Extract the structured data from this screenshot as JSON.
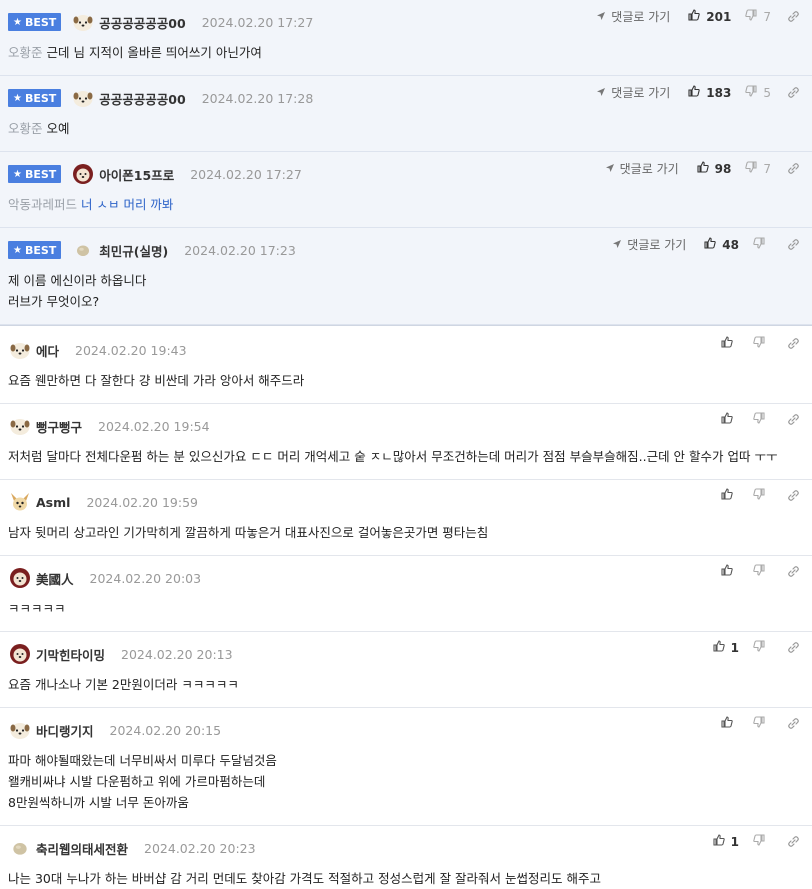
{
  "best_badge_label": "BEST",
  "goto_label": "댓글로 가기",
  "best_comments": [
    {
      "nick": "공공공공공공00",
      "date": "2024.02.20 17:27",
      "up": "201",
      "down": "7",
      "mention": "오황준",
      "text": "근데 님 지적이 올바른 띄어쓰기 아닌가여",
      "avatar": "dog-avatar-icon"
    },
    {
      "nick": "공공공공공공00",
      "date": "2024.02.20 17:28",
      "up": "183",
      "down": "5",
      "mention": "오황준",
      "text": "오예",
      "avatar": "dog-avatar-icon"
    },
    {
      "nick": "아이폰15프로",
      "date": "2024.02.20 17:27",
      "up": "98",
      "down": "7",
      "mention": "악동과레퍼드",
      "text": "너 ㅅㅂ 머리 까봐",
      "avatar": "poodle-avatar-icon"
    },
    {
      "nick": "최민규(실명)",
      "date": "2024.02.20 17:23",
      "up": "48",
      "down": "",
      "mention": "",
      "text": "제 이름 에신이라 하옵니다\n러브가 무엇이오?",
      "avatar": "blob-avatar-icon"
    }
  ],
  "comments": [
    {
      "nick": "에다",
      "date": "2024.02.20 19:43",
      "up": "",
      "text": "요즘 웬만하면 다 잘한다 걍 비싼데 가라 앙아서 해주드라",
      "avatar": "dog-avatar-icon"
    },
    {
      "nick": "뻥구뻥구",
      "date": "2024.02.20 19:54",
      "up": "",
      "text": "저처럼 달마다 전체다운펌 하는 분 있으신가요 ㄷㄷ 머리 개억세고 숱 ㅈㄴ많아서 무조건하는데 머리가 점점 부슬부슬해짐..근데 안 할수가 업따 ㅜㅜ",
      "avatar": "dog-avatar-icon"
    },
    {
      "nick": "Asml",
      "date": "2024.02.20 19:59",
      "up": "",
      "text": "남자 뒷머리 상고라인 기가막히게 깔끔하게 따놓은거 대표사진으로 걸어놓은곳가면 평타는침",
      "avatar": "chihuahua-avatar-icon"
    },
    {
      "nick": "美國人",
      "date": "2024.02.20 20:03",
      "up": "",
      "text": "ㅋㅋㅋㅋㅋ",
      "avatar": "poodle-avatar-icon"
    },
    {
      "nick": "기막힌타이밍",
      "date": "2024.02.20 20:13",
      "up": "1",
      "text": "요즘 개나소나 기본 2만원이더라 ㅋㅋㅋㅋㅋ",
      "avatar": "poodle-avatar-icon"
    },
    {
      "nick": "바디랭기지",
      "date": "2024.02.20 20:15",
      "up": "",
      "text": "파마 해야될때왔는데 너무비싸서 미루다 두달넘것음\n왤캐비싸냐 시발 다운펌하고 위에 가르마펌하는데\n8만원씩하니까 시발 너무 돈아까움",
      "avatar": "dog-avatar-icon"
    },
    {
      "nick": "축리웹의태세전환",
      "date": "2024.02.20 20:23",
      "up": "1",
      "text": "나는 30대 누나가 하는 바버샵 감 거리 먼데도 찾아감 가격도 적절하고 정성스럽게 잘 잘라줘서 눈썹정리도 해주고",
      "avatar": "blob-avatar-icon"
    }
  ]
}
